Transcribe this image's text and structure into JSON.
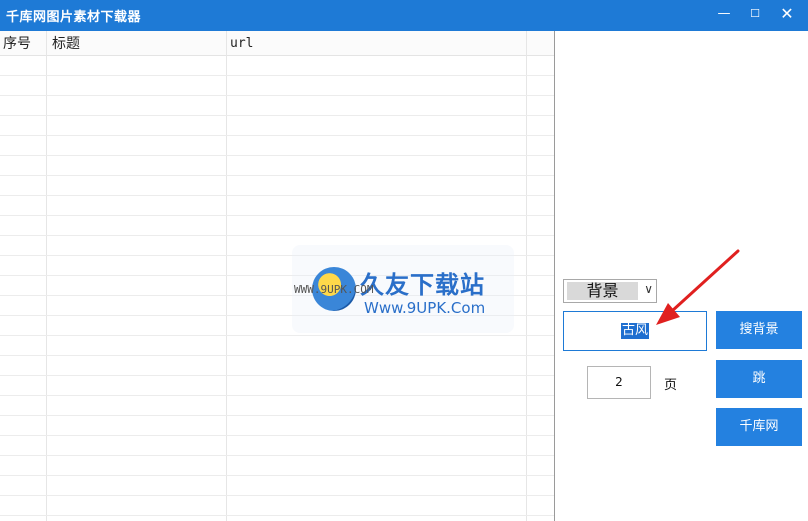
{
  "window": {
    "title": "千库网图片素材下载器",
    "minimize_icon": "minimize-icon",
    "maximize_icon": "maximize-icon",
    "close_icon": "close-icon"
  },
  "grid": {
    "columns": [
      "序号",
      "标题",
      "url"
    ]
  },
  "watermark": {
    "brand": "久友下载站",
    "url_small": "WWW.9UPK.COM",
    "url_large": "Www.9UPK.Com"
  },
  "controls": {
    "category_selected": "背景",
    "keyword_value": "古风",
    "page_value": "2",
    "page_unit": "页",
    "search_button": "搜背景",
    "jump_button": "跳",
    "site_button": "千库网"
  },
  "colors": {
    "titlebar": "#1e7ad6",
    "button": "#2481e0",
    "annotation_arrow": "#e0201f"
  }
}
